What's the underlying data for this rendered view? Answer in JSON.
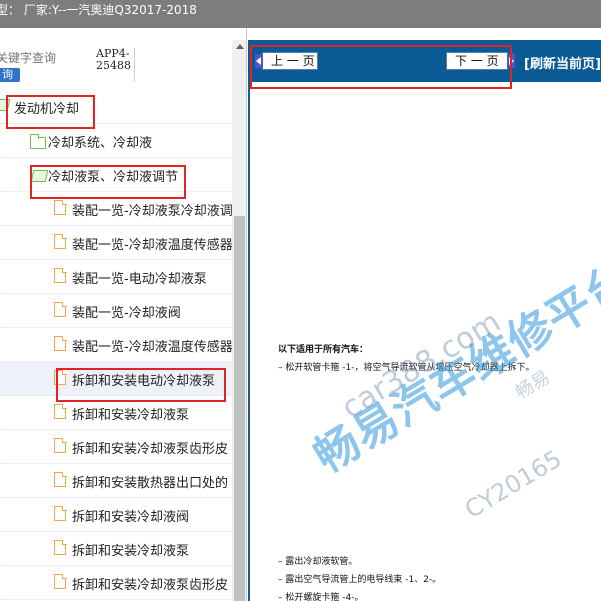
{
  "title_bar": {
    "text": "型：  厂家:Y--一汽奥迪Q32017-2018"
  },
  "search": {
    "placeholder": "关键字查询",
    "button_label": "询"
  },
  "app_code": {
    "line1": "APP4-",
    "line2": "25488"
  },
  "tree": {
    "items": [
      {
        "label": "发动机冷却",
        "icon": "folder-open-icon",
        "level": 0
      },
      {
        "label": "冷却系统、冷却液",
        "icon": "folder-icon",
        "level": 1
      },
      {
        "label": "冷却液泵、冷却液调节",
        "icon": "folder-open-icon",
        "level": 1
      },
      {
        "label": "装配一览-冷却液泵冷却液调",
        "icon": "doc-icon",
        "level": 2
      },
      {
        "label": "装配一览-冷却液温度传感器",
        "icon": "doc-icon",
        "level": 2
      },
      {
        "label": "装配一览-电动冷却液泵",
        "icon": "doc-icon",
        "level": 2
      },
      {
        "label": "装配一览-冷却液阀",
        "icon": "doc-icon",
        "level": 2
      },
      {
        "label": "装配一览-冷却液温度传感器",
        "icon": "doc-icon",
        "level": 2
      },
      {
        "label": "拆卸和安装电动冷却液泵",
        "icon": "doc-icon",
        "level": 2,
        "selected": true
      },
      {
        "label": "拆卸和安装冷却液泵",
        "icon": "doc-icon",
        "level": 2
      },
      {
        "label": "拆卸和安装冷却液泵齿形皮",
        "icon": "doc-icon",
        "level": 2
      },
      {
        "label": "拆卸和安装散热器出口处的",
        "icon": "doc-icon",
        "level": 2
      },
      {
        "label": "拆卸和安装冷却液阀",
        "icon": "doc-icon",
        "level": 2
      },
      {
        "label": "拆卸和安装冷却液泵",
        "icon": "doc-icon",
        "level": 2
      },
      {
        "label": "拆卸和安装冷却液泵齿形皮",
        "icon": "doc-icon",
        "level": 2
      }
    ]
  },
  "toolbar": {
    "prev_label": "上 一 页",
    "next_label": "下 一 页",
    "refresh_label": "[刷新当前页]"
  },
  "document": {
    "heading": "以下适用于所有汽车：",
    "steps": [
      "–  松开软管卡箍 -1-，将空气导流软管从增压空气冷却器上拆下。",
      "–  露出冷却液软管。",
      "–  露出空气导流管上的电导线束 -1、2-。",
      "–  松开螺旋卡箍 -4-。"
    ]
  },
  "watermark": {
    "main": "畅易汽车维修平台",
    "url": "car388.com",
    "code": "CY20165",
    "small": "畅易"
  },
  "colors": {
    "toolbar_bg": "#0a5a96",
    "highlight": "#e02424",
    "watermark": "#2f96de"
  }
}
